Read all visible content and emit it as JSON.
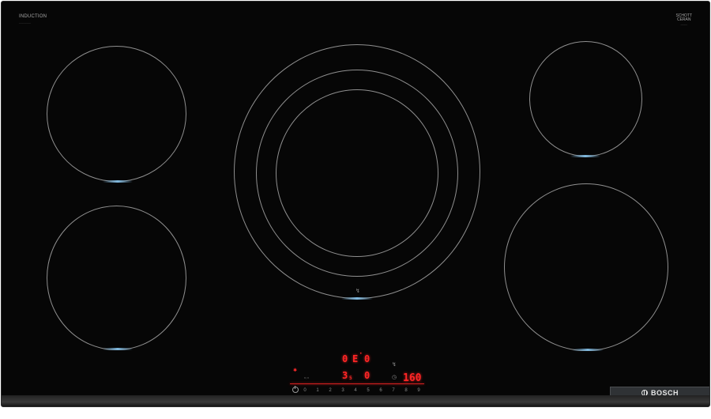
{
  "brand": {
    "top_left_title": "INDUCTION",
    "top_left_sub": "________",
    "top_right_title": "SCHOTT",
    "top_right_title2": "CERAN",
    "top_right_sub": "_____",
    "logo_text": "BOSCH"
  },
  "colors": {
    "surface": "#060606",
    "burner_ring": "#8f8f8f",
    "indicator_blue": "#7fb8de",
    "display_red": "#ff2525",
    "badge_bg": "#2f3235"
  },
  "icons": {
    "center_zone": "pan-steam-icon",
    "timer": "clock-icon",
    "fry": "pan-sensor-icon",
    "power": "power-icon"
  },
  "display": {
    "row1_left": "0",
    "row1_mid": "E",
    "row1_right": "0",
    "row2_left": "3",
    "row2_left_sub": "5",
    "row2_mid": "0",
    "right_value": "160",
    "right_prefix": "1",
    "left_small_labels": "8 | 8",
    "flame_glyph": "✱"
  },
  "slider": {
    "levels": [
      "0",
      "1",
      "2",
      "3",
      "4",
      "5",
      "6",
      "7",
      "8",
      "9"
    ]
  }
}
